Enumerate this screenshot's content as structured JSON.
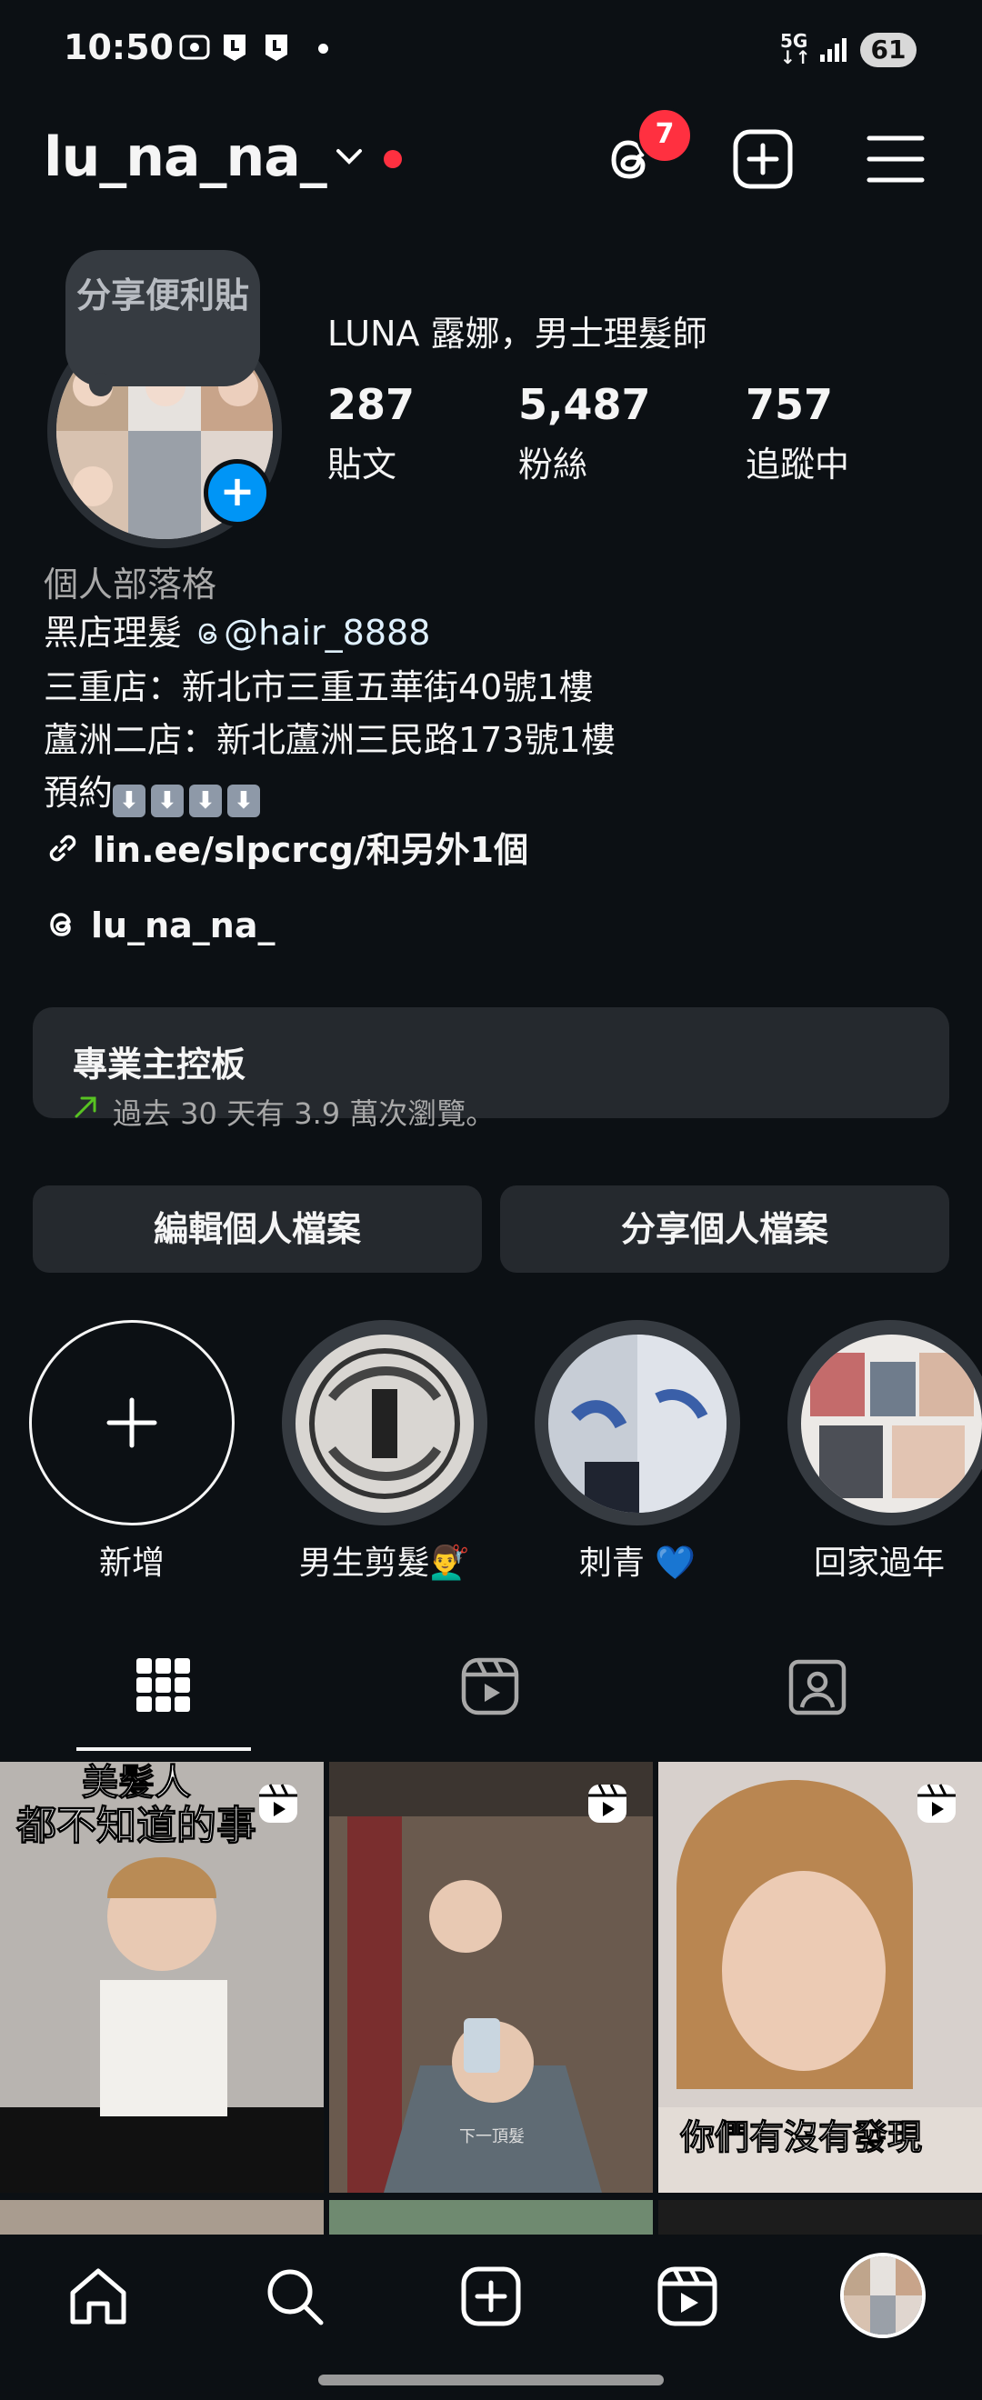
{
  "status_bar": {
    "time": "10:50",
    "network": "5G",
    "battery": "61"
  },
  "header": {
    "username": "lu_na_na_",
    "threads_badge_count": "7",
    "icons": [
      "threads-icon",
      "create-icon",
      "menu-icon"
    ]
  },
  "profile": {
    "note_text": "分享便利貼",
    "display_name": "LUNA 露娜，男士理髮師",
    "stats": [
      {
        "value": "287",
        "label": "貼文"
      },
      {
        "value": "5,487",
        "label": "粉絲"
      },
      {
        "value": "757",
        "label": "追蹤中"
      }
    ],
    "category": "個人部落格",
    "bio_line1_prefix": "黑店理髮",
    "bio_mention": "@hair_8888",
    "bio_line2": "三重店：新北市三重五華街40號1樓",
    "bio_line3": "蘆洲二店：新北蘆洲三民路173號1樓",
    "bio_line4": "預約",
    "bio_arrows": [
      "⬇",
      "⬇",
      "⬇",
      "⬇"
    ],
    "link": "lin.ee/slpcrcg/和另外1個",
    "threads_handle": "lu_na_na_"
  },
  "dashboard": {
    "title": "專業主控板",
    "subtitle": "過去 30 天有 3.9 萬次瀏覽。"
  },
  "buttons": {
    "edit": "編輯個人檔案",
    "share": "分享個人檔案"
  },
  "highlights": [
    {
      "label": "新增"
    },
    {
      "label": "男生剪髮💇‍♂️"
    },
    {
      "label": "刺青 💙"
    },
    {
      "label": "回家過年"
    }
  ],
  "tabs": [
    "grid-tab",
    "reels-tab",
    "tagged-tab"
  ],
  "posts": [
    {
      "caption_top": "美髮人",
      "caption": "都不知道的事"
    },
    {
      "caption": "下一頂髮"
    },
    {
      "caption": "你們有沒有發現"
    }
  ],
  "colors": {
    "background": "#0c1014",
    "accent_blue": "#0095f6",
    "badge_red": "#ff3040",
    "card": "#25292e"
  }
}
